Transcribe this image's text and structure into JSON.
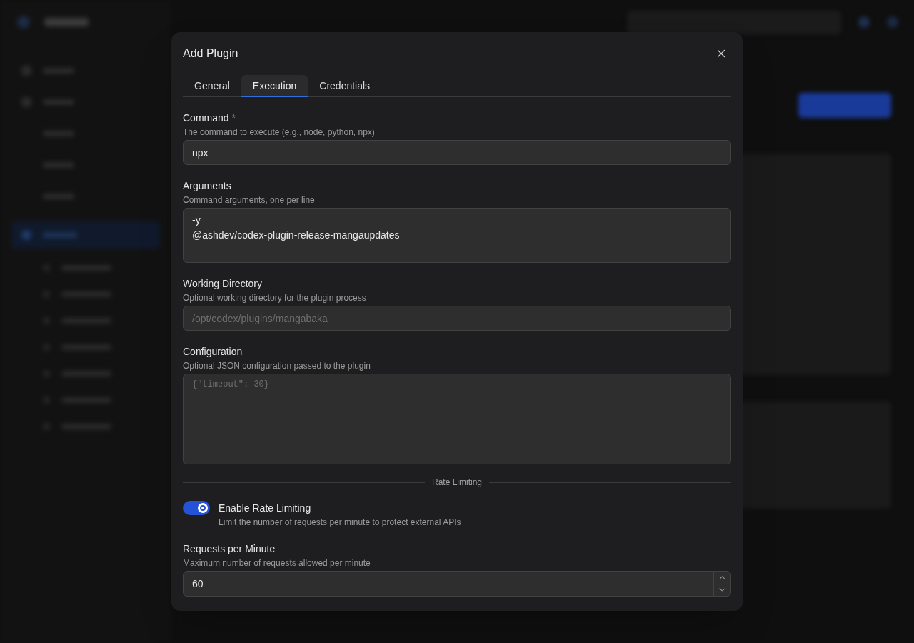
{
  "modal": {
    "title": "Add Plugin"
  },
  "tabs": [
    {
      "label": "General",
      "selected": false
    },
    {
      "label": "Execution",
      "selected": true
    },
    {
      "label": "Credentials",
      "selected": false
    }
  ],
  "fields": [
    {
      "kind": "text",
      "label": "Command",
      "required_mark": "*",
      "description": "The command to execute (e.g., node, python, npx)",
      "value": "npx"
    },
    {
      "kind": "textarea",
      "label": "Arguments",
      "description": "Command arguments, one per line",
      "value": "-y\n@ashdev/codex-plugin-release-mangaupdates"
    },
    {
      "kind": "text",
      "label": "Working Directory",
      "description": "Optional working directory for the plugin process",
      "placeholder": "/opt/codex/plugins/mangabaka"
    },
    {
      "kind": "code",
      "label": "Configuration",
      "description": "Optional JSON configuration passed to the plugin",
      "placeholder": "{\"timeout\": 30}"
    }
  ],
  "rate_limiting": {
    "divider": "Rate Limiting",
    "toggle": {
      "label": "Enable Rate Limiting",
      "description": "Limit the number of requests per minute to protect external APIs",
      "on": true
    },
    "requests": {
      "label": "Requests per Minute",
      "description": "Maximum number of requests allowed per minute",
      "value": "60"
    }
  }
}
